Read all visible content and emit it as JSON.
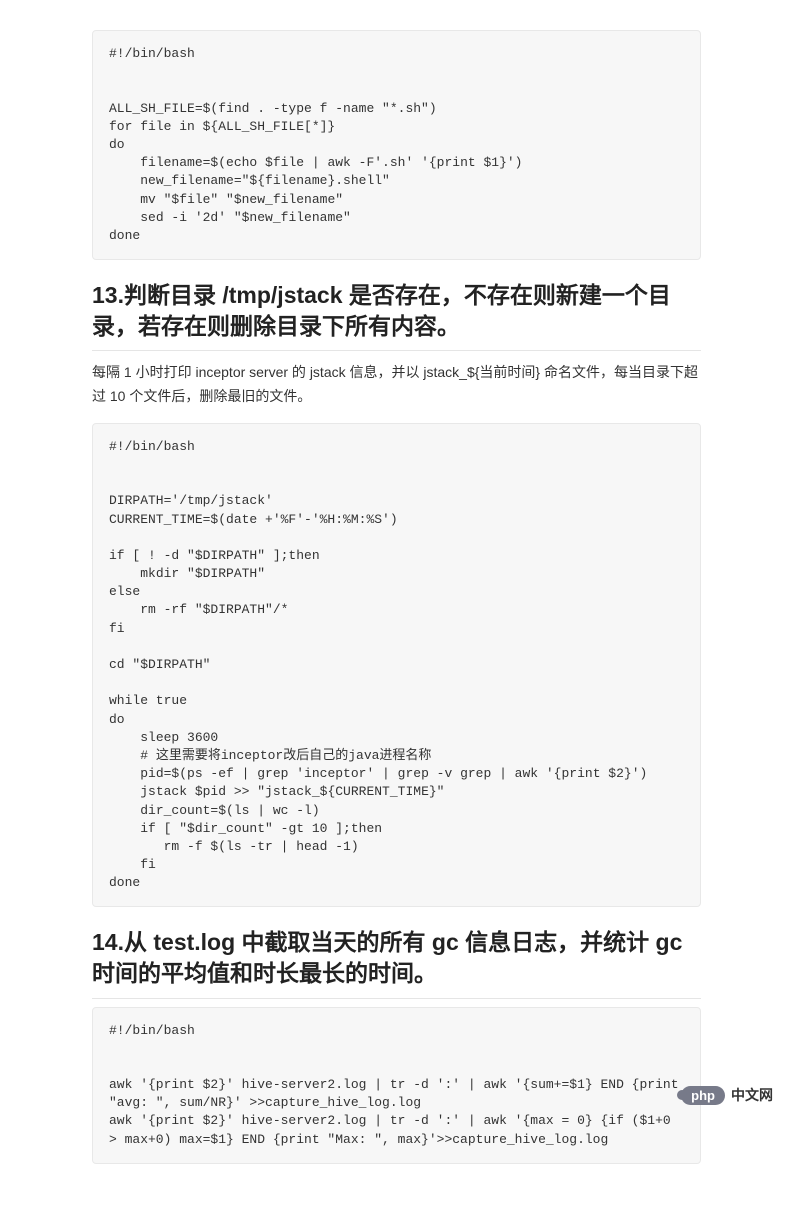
{
  "code_block_1": "#!/bin/bash\n\n\nALL_SH_FILE=$(find . -type f -name \"*.sh\")\nfor file in ${ALL_SH_FILE[*]}\ndo\n    filename=$(echo $file | awk -F'.sh' '{print $1}')\n    new_filename=\"${filename}.shell\"\n    mv \"$file\" \"$new_filename\"\n    sed -i '2d' \"$new_filename\"\ndone",
  "heading_13": "13.判断目录 /tmp/jstack 是否存在，不存在则新建一个目录，若存在则删除目录下所有内容。",
  "para_13": "每隔 1 小时打印 inceptor server 的 jstack 信息，并以 jstack_${当前时间} 命名文件，每当目录下超过 10 个文件后，删除最旧的文件。",
  "code_block_2": "#!/bin/bash\n\n\nDIRPATH='/tmp/jstack'\nCURRENT_TIME=$(date +'%F'-'%H:%M:%S')\n\nif [ ! -d \"$DIRPATH\" ];then\n    mkdir \"$DIRPATH\"\nelse\n    rm -rf \"$DIRPATH\"/*\nfi\n\ncd \"$DIRPATH\"\n\nwhile true\ndo\n    sleep 3600\n    # 这里需要将inceptor改后自己的java进程名称\n    pid=$(ps -ef | grep 'inceptor' | grep -v grep | awk '{print $2}')\n    jstack $pid >> \"jstack_${CURRENT_TIME}\"\n    dir_count=$(ls | wc -l)\n    if [ \"$dir_count\" -gt 10 ];then\n       rm -f $(ls -tr | head -1)\n    fi\ndone",
  "heading_14": "14.从 test.log 中截取当天的所有 gc 信息日志，并统计 gc 时间的平均值和时长最长的时间。",
  "code_block_3": "#!/bin/bash\n\n\nawk '{print $2}' hive-server2.log | tr -d ':' | awk '{sum+=$1} END {print \"avg: \", sum/NR}' >>capture_hive_log.log\nawk '{print $2}' hive-server2.log | tr -d ':' | awk '{max = 0} {if ($1+0 > max+0) max=$1} END {print \"Max: \", max}'>>capture_hive_log.log",
  "footer": {
    "pill": "php",
    "text": "中文网"
  }
}
